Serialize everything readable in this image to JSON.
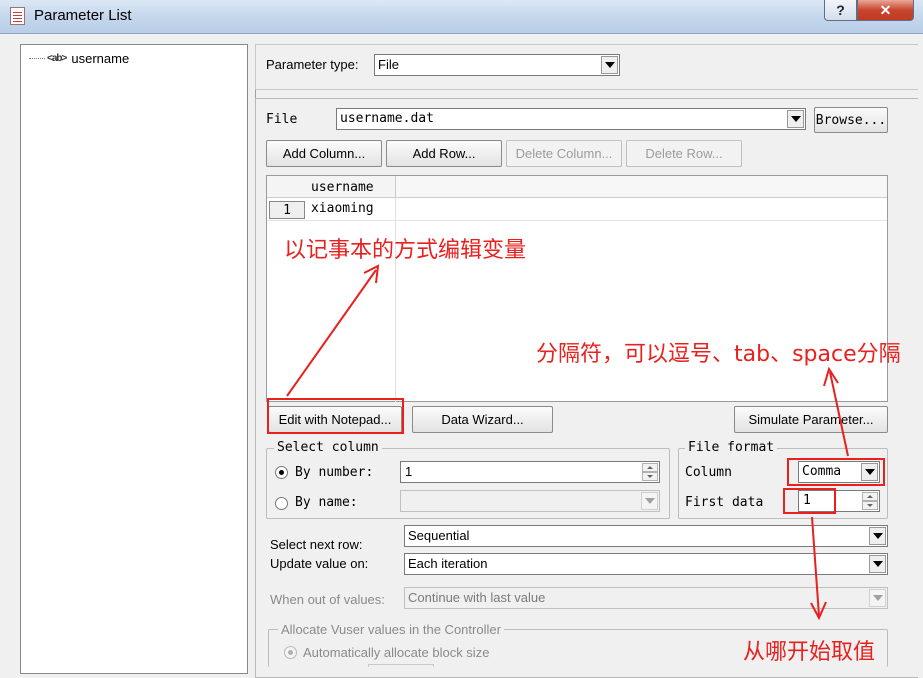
{
  "window": {
    "title": "Parameter List",
    "help_glyph": "?",
    "close_glyph": "✕"
  },
  "tree": {
    "items": [
      {
        "icon": "<ab>",
        "label": "username"
      }
    ]
  },
  "param_type": {
    "label": "Parameter type:",
    "value": "File"
  },
  "file": {
    "label": "File",
    "value": "username.dat",
    "browse_label": "Browse...",
    "add_column_label": "Add Column...",
    "add_row_label": "Add Row...",
    "delete_column_label": "Delete Column...",
    "delete_row_label": "Delete Row..."
  },
  "grid": {
    "columns": [
      "username"
    ],
    "rows": [
      {
        "num": "1",
        "cells": [
          "xiaoming"
        ]
      }
    ]
  },
  "actions": {
    "edit_notepad_label": "Edit with Notepad...",
    "data_wizard_label": "Data Wizard...",
    "simulate_label": "Simulate Parameter..."
  },
  "select_column": {
    "title": "Select column",
    "by_number_label": "By number:",
    "by_number_value": "1",
    "by_name_label": "By name:",
    "by_name_value": "",
    "selected": "by_number"
  },
  "file_format": {
    "title": "File format",
    "column_label": "Column",
    "column_value": "Comma",
    "first_data_label": "First data",
    "first_data_value": "1"
  },
  "options": {
    "select_next_row_label": "Select next row:",
    "select_next_row_value": "Sequential",
    "update_value_label": "Update value on:",
    "update_value_value": "Each iteration",
    "out_of_values_label": "When out of values:",
    "out_of_values_value": "Continue with last value"
  },
  "allocate": {
    "title": "Allocate Vuser values in the Controller",
    "auto_label": "Automatically allocate block size"
  },
  "annotations": {
    "notepad": "以记事本的方式编辑变量",
    "separator": "分隔符，可以逗号、tab、space分隔",
    "first_data": "从哪开始取值"
  },
  "colors": {
    "annotation": "#e8201e"
  }
}
